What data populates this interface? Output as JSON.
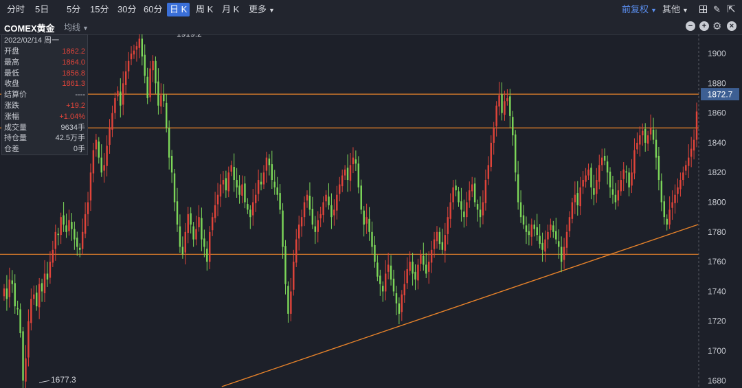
{
  "toolbar": {
    "periods": [
      "分时",
      "5日",
      "5分",
      "15分",
      "30分",
      "60分",
      "日 K",
      "周 K",
      "月 K",
      "更多"
    ],
    "active_period": "日 K",
    "fq_label": "前复权",
    "other_label": "其他"
  },
  "subbar": {
    "instrument": "COMEX黄金",
    "indicator": "均线"
  },
  "info": {
    "date": "2022/02/14 周一",
    "rows": [
      {
        "label": "开盘",
        "value": "1862.2",
        "color": "#e0443a"
      },
      {
        "label": "最高",
        "value": "1864.0",
        "color": "#e0443a"
      },
      {
        "label": "最低",
        "value": "1856.8",
        "color": "#e0443a"
      },
      {
        "label": "收盘",
        "value": "1861.3",
        "color": "#e0443a"
      },
      {
        "label": "结算价",
        "value": "----",
        "color": "#c9ccd3"
      },
      {
        "label": "涨跌",
        "value": "+19.2",
        "color": "#e0443a"
      },
      {
        "label": "涨幅",
        "value": "+1.04%",
        "color": "#e0443a"
      },
      {
        "label": "成交量",
        "value": "9634手",
        "color": "#c9ccd3"
      },
      {
        "label": "持仓量",
        "value": "42.5万手",
        "color": "#c9ccd3"
      },
      {
        "label": "仓差",
        "value": "0手",
        "color": "#c9ccd3"
      }
    ]
  },
  "colors": {
    "up": "#e0443a",
    "down": "#7cd659",
    "support": "#e8832a",
    "badge": "#3d5f93"
  },
  "chart_data": {
    "type": "candlestick",
    "ylim": [
      1676,
      1912
    ],
    "yticks": [
      1680,
      1700,
      1720,
      1740,
      1760,
      1780,
      1800,
      1820,
      1840,
      1860,
      1880,
      1900
    ],
    "last_price": "1872.7",
    "high_label": "1919.2",
    "low_label": "1677.3",
    "horizontal_levels": [
      1872.7,
      1850,
      1765
    ],
    "trendline": [
      [
        0.315,
        1676
      ],
      [
        1.0,
        1785
      ]
    ],
    "closes": [
      1742,
      1735,
      1748,
      1745,
      1730,
      1728,
      1712,
      1680,
      1695,
      1720,
      1735,
      1738,
      1730,
      1745,
      1740,
      1752,
      1748,
      1760,
      1768,
      1780,
      1778,
      1790,
      1785,
      1780,
      1788,
      1782,
      1775,
      1770,
      1768,
      1780,
      1792,
      1800,
      1820,
      1835,
      1842,
      1830,
      1820,
      1825,
      1838,
      1850,
      1860,
      1870,
      1875,
      1865,
      1880,
      1888,
      1895,
      1900,
      1902,
      1905,
      1910,
      1898,
      1885,
      1870,
      1890,
      1895,
      1880,
      1865,
      1872,
      1868,
      1850,
      1830,
      1820,
      1800,
      1785,
      1770,
      1765,
      1780,
      1792,
      1785,
      1775,
      1782,
      1790,
      1775,
      1770,
      1760,
      1780,
      1790,
      1798,
      1805,
      1812,
      1815,
      1808,
      1820,
      1825,
      1815,
      1810,
      1805,
      1812,
      1800,
      1795,
      1790,
      1800,
      1805,
      1815,
      1812,
      1820,
      1830,
      1825,
      1815,
      1810,
      1805,
      1795,
      1770,
      1745,
      1725,
      1740,
      1760,
      1775,
      1785,
      1790,
      1800,
      1805,
      1795,
      1785,
      1780,
      1788,
      1792,
      1800,
      1805,
      1798,
      1790,
      1795,
      1805,
      1812,
      1818,
      1822,
      1815,
      1825,
      1830,
      1826,
      1810,
      1795,
      1785,
      1790,
      1780,
      1770,
      1760,
      1750,
      1745,
      1740,
      1752,
      1758,
      1748,
      1740,
      1732,
      1725,
      1738,
      1745,
      1755,
      1760,
      1752,
      1748,
      1758,
      1765,
      1758,
      1752,
      1760,
      1768,
      1775,
      1780,
      1772,
      1768,
      1778,
      1790,
      1800,
      1810,
      1808,
      1800,
      1795,
      1790,
      1800,
      1808,
      1812,
      1800,
      1795,
      1790,
      1800,
      1815,
      1825,
      1840,
      1850,
      1865,
      1872,
      1860,
      1868,
      1870,
      1858,
      1845,
      1820,
      1800,
      1790,
      1785,
      1780,
      1778,
      1785,
      1782,
      1778,
      1772,
      1768,
      1775,
      1780,
      1785,
      1780,
      1775,
      1770,
      1760,
      1770,
      1780,
      1790,
      1800,
      1805,
      1798,
      1810,
      1815,
      1818,
      1822,
      1810,
      1805,
      1815,
      1825,
      1830,
      1828,
      1820,
      1810,
      1805,
      1800,
      1808,
      1815,
      1822,
      1820,
      1810,
      1820,
      1835,
      1840,
      1845,
      1848,
      1840,
      1845,
      1850,
      1842,
      1830,
      1815,
      1800,
      1790,
      1785,
      1795,
      1800,
      1805,
      1810,
      1815,
      1820,
      1825,
      1830,
      1836,
      1842,
      1861
    ]
  }
}
